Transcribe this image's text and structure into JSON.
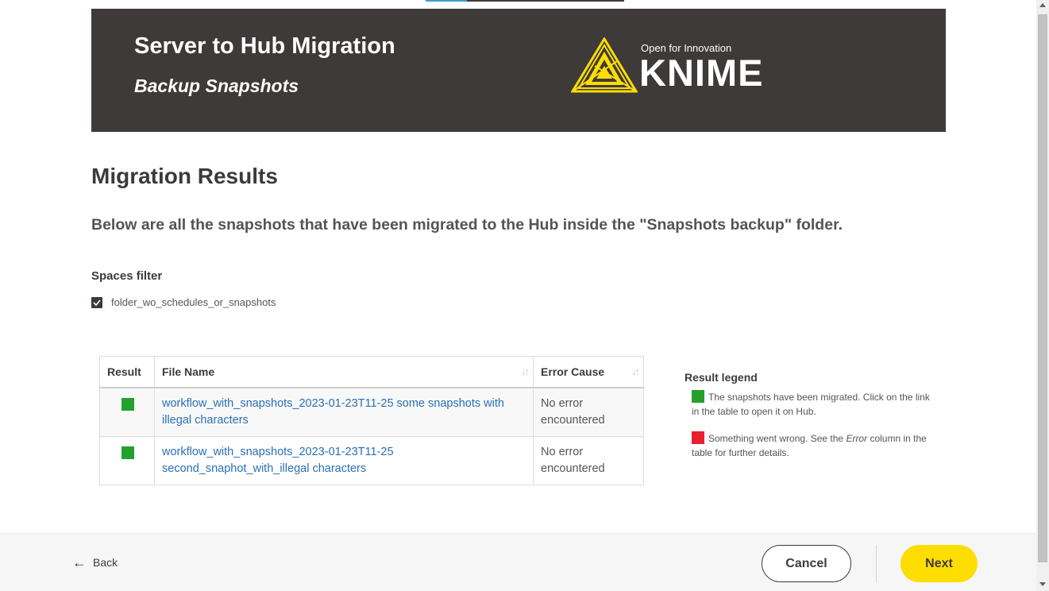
{
  "header": {
    "title": "Server to Hub Migration",
    "subtitle": "Backup Snapshots",
    "logo_tagline": "Open for Innovation",
    "logo_word": "KNIME"
  },
  "main": {
    "section_title": "Migration Results",
    "description": "Below are all the snapshots that have been migrated to the Hub inside the \"Snapshots backup\" folder."
  },
  "filter": {
    "title": "Spaces filter",
    "options": [
      {
        "label": "folder_wo_schedules_or_snapshots",
        "checked": true
      }
    ]
  },
  "table": {
    "columns": [
      "Result",
      "File Name",
      "Error Cause"
    ],
    "rows": [
      {
        "result": "success",
        "file_name": "workflow_with_snapshots_2023-01-23T11-25 some snapshots with illegal characters",
        "error_cause": "No error encountered"
      },
      {
        "result": "success",
        "file_name": "workflow_with_snapshots_2023-01-23T11-25 second_snaphot_with_illegal characters",
        "error_cause": "No error encountered"
      }
    ]
  },
  "legend": {
    "title": "Result legend",
    "items": [
      {
        "color": "#23a12c",
        "text_before": "The snapshots have been migrated. Click on the link in the table to open it on Hub.",
        "emphasis": "",
        "text_after": ""
      },
      {
        "color": "#e8202e",
        "text_before": "Something went wrong. See the ",
        "emphasis": "Error",
        "text_after": " column in the table for further details."
      }
    ]
  },
  "footer": {
    "back_label": "Back",
    "cancel_label": "Cancel",
    "next_label": "Next"
  },
  "colors": {
    "header_bg": "#3e3a39",
    "accent_yellow": "#fdde00",
    "success": "#23a12c",
    "error": "#e8202e",
    "link": "#2b6fb4"
  },
  "icons": [
    "checkbox-checked-icon",
    "sort-icon",
    "back-arrow-icon",
    "knime-logo-icon"
  ]
}
